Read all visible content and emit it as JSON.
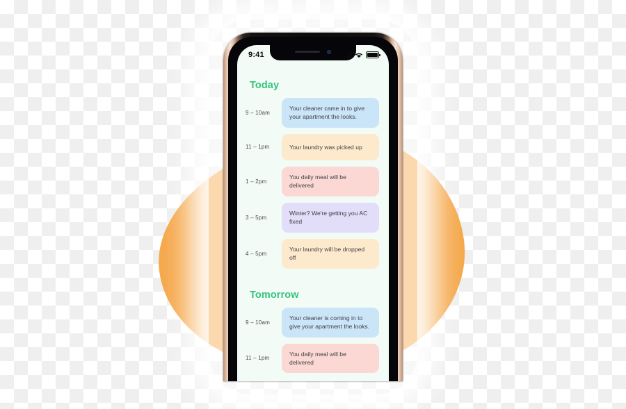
{
  "background": {
    "canvas": "transparent-checkerboard",
    "blob_color": "#f5a84b"
  },
  "phone": {
    "frame_color": "#d8b49b",
    "bezel_color": "#05050a",
    "screen_background": "#f2fbf5",
    "notch": {
      "speaker_name": "earpiece-speaker",
      "camera_name": "front-camera"
    }
  },
  "status_bar": {
    "time": "9:41",
    "icons": [
      "cellular-signal-icon",
      "wifi-icon",
      "battery-icon"
    ],
    "battery_level": "100"
  },
  "app": {
    "accent_color": "#35c37d",
    "sections": [
      {
        "title": "Today",
        "events": [
          {
            "time": "9 – 10am",
            "text": "Your cleaner came in to give your apartment the looks.",
            "color": "#cbe5f8",
            "color_class": "c-blue",
            "lines": 2
          },
          {
            "time": "11 – 1pm",
            "text": "Your laundry was picked up",
            "color": "#fdeacd",
            "color_class": "c-peach",
            "lines": 1
          },
          {
            "time": "1 – 2pm",
            "text": "You daily meal will be delivered",
            "color": "#fbd8d3",
            "color_class": "c-pink",
            "lines": 1
          },
          {
            "time": "3 – 5pm",
            "text": "Winter? We're getting you AC fixed",
            "color": "#e2ddf8",
            "color_class": "c-lavender",
            "lines": 1
          },
          {
            "time": "4 – 5pm",
            "text": "Your laundry will be dropped off",
            "color": "#fdeacd",
            "color_class": "c-peach",
            "lines": 1
          }
        ]
      },
      {
        "title": "Tomorrow",
        "events": [
          {
            "time": "9 – 10am",
            "text": "Your cleaner is coming in to give your apartment the looks.",
            "color": "#cbe5f8",
            "color_class": "c-blue",
            "lines": 2
          },
          {
            "time": "11 – 1pm",
            "text": "You daily meal will be delivered",
            "color": "#fbd8d3",
            "color_class": "c-pink",
            "lines": 1
          }
        ]
      }
    ]
  }
}
